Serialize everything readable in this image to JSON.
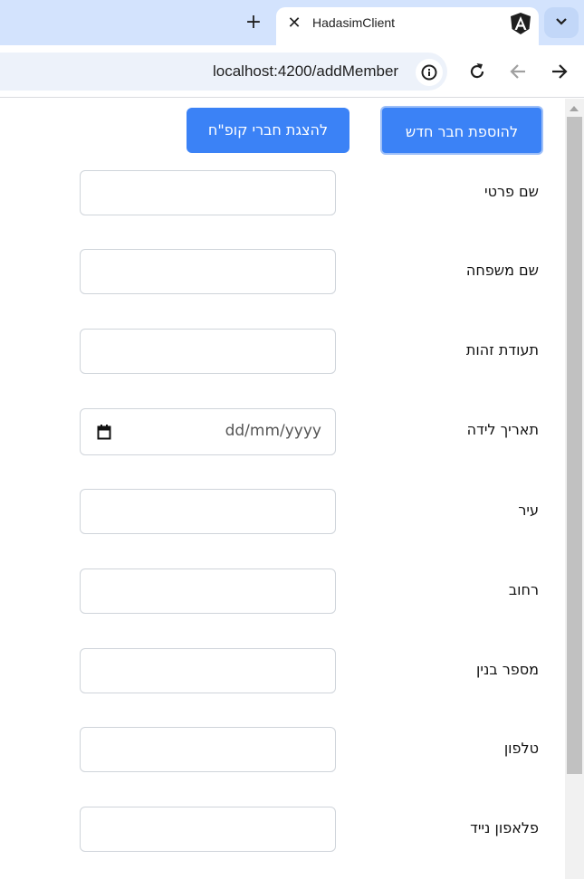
{
  "browser": {
    "tab_title": "HadasimClient",
    "tab_close_glyph": "✕",
    "new_tab_glyph": "+",
    "url": "localhost:4200/addMember",
    "favicon_icon": "angular-logo-icon"
  },
  "buttons": {
    "add_member": "להוספת חבר חדש",
    "show_members": "להצגת חברי קופ\"ח"
  },
  "form": {
    "fields": [
      {
        "label": "שם פרטי",
        "value": "",
        "type": "text"
      },
      {
        "label": "שם משפחה",
        "value": "",
        "type": "text"
      },
      {
        "label": "תעודת זהות",
        "value": "",
        "type": "text"
      },
      {
        "label": "תאריך לידה",
        "value": "",
        "type": "date",
        "placeholder": "dd/mm/yyyy"
      },
      {
        "label": "עיר",
        "value": "",
        "type": "text"
      },
      {
        "label": "רחוב",
        "value": "",
        "type": "text"
      },
      {
        "label": "מספר בנין",
        "value": "",
        "type": "text"
      },
      {
        "label": "טלפון",
        "value": "",
        "type": "text"
      },
      {
        "label": "פלאפון נייד",
        "value": "",
        "type": "text"
      }
    ]
  },
  "colors": {
    "primary_button": "#3b82f6",
    "tabbar": "#d3e3fd"
  }
}
